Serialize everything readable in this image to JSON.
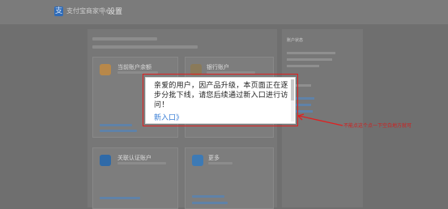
{
  "header": {
    "brand": "支付宝商家中心",
    "page_title": "设置",
    "logo_glyph": "支"
  },
  "cards": [
    {
      "title": "当前账户余额",
      "icon": "yuan-icon",
      "color": "#b8884a"
    },
    {
      "title": "银行账户",
      "icon": "bank-icon",
      "color": "#8a7a5a"
    },
    {
      "title": "关联认证账户",
      "icon": "link-account-icon",
      "color": "#2f6aa8"
    },
    {
      "title": "更多",
      "icon": "more-icon",
      "color": "#3d7ab5"
    }
  ],
  "sidebar": {
    "title": "账户状态"
  },
  "modal": {
    "message": "亲爱的用户，因产品升级，本页面正在逐步分批下线，请您后续通过新入口进行访问！",
    "link_label": "新入口》"
  },
  "annotation": {
    "text": "不能点这个点一下空白地方就可",
    "color": "#d21d1d"
  }
}
